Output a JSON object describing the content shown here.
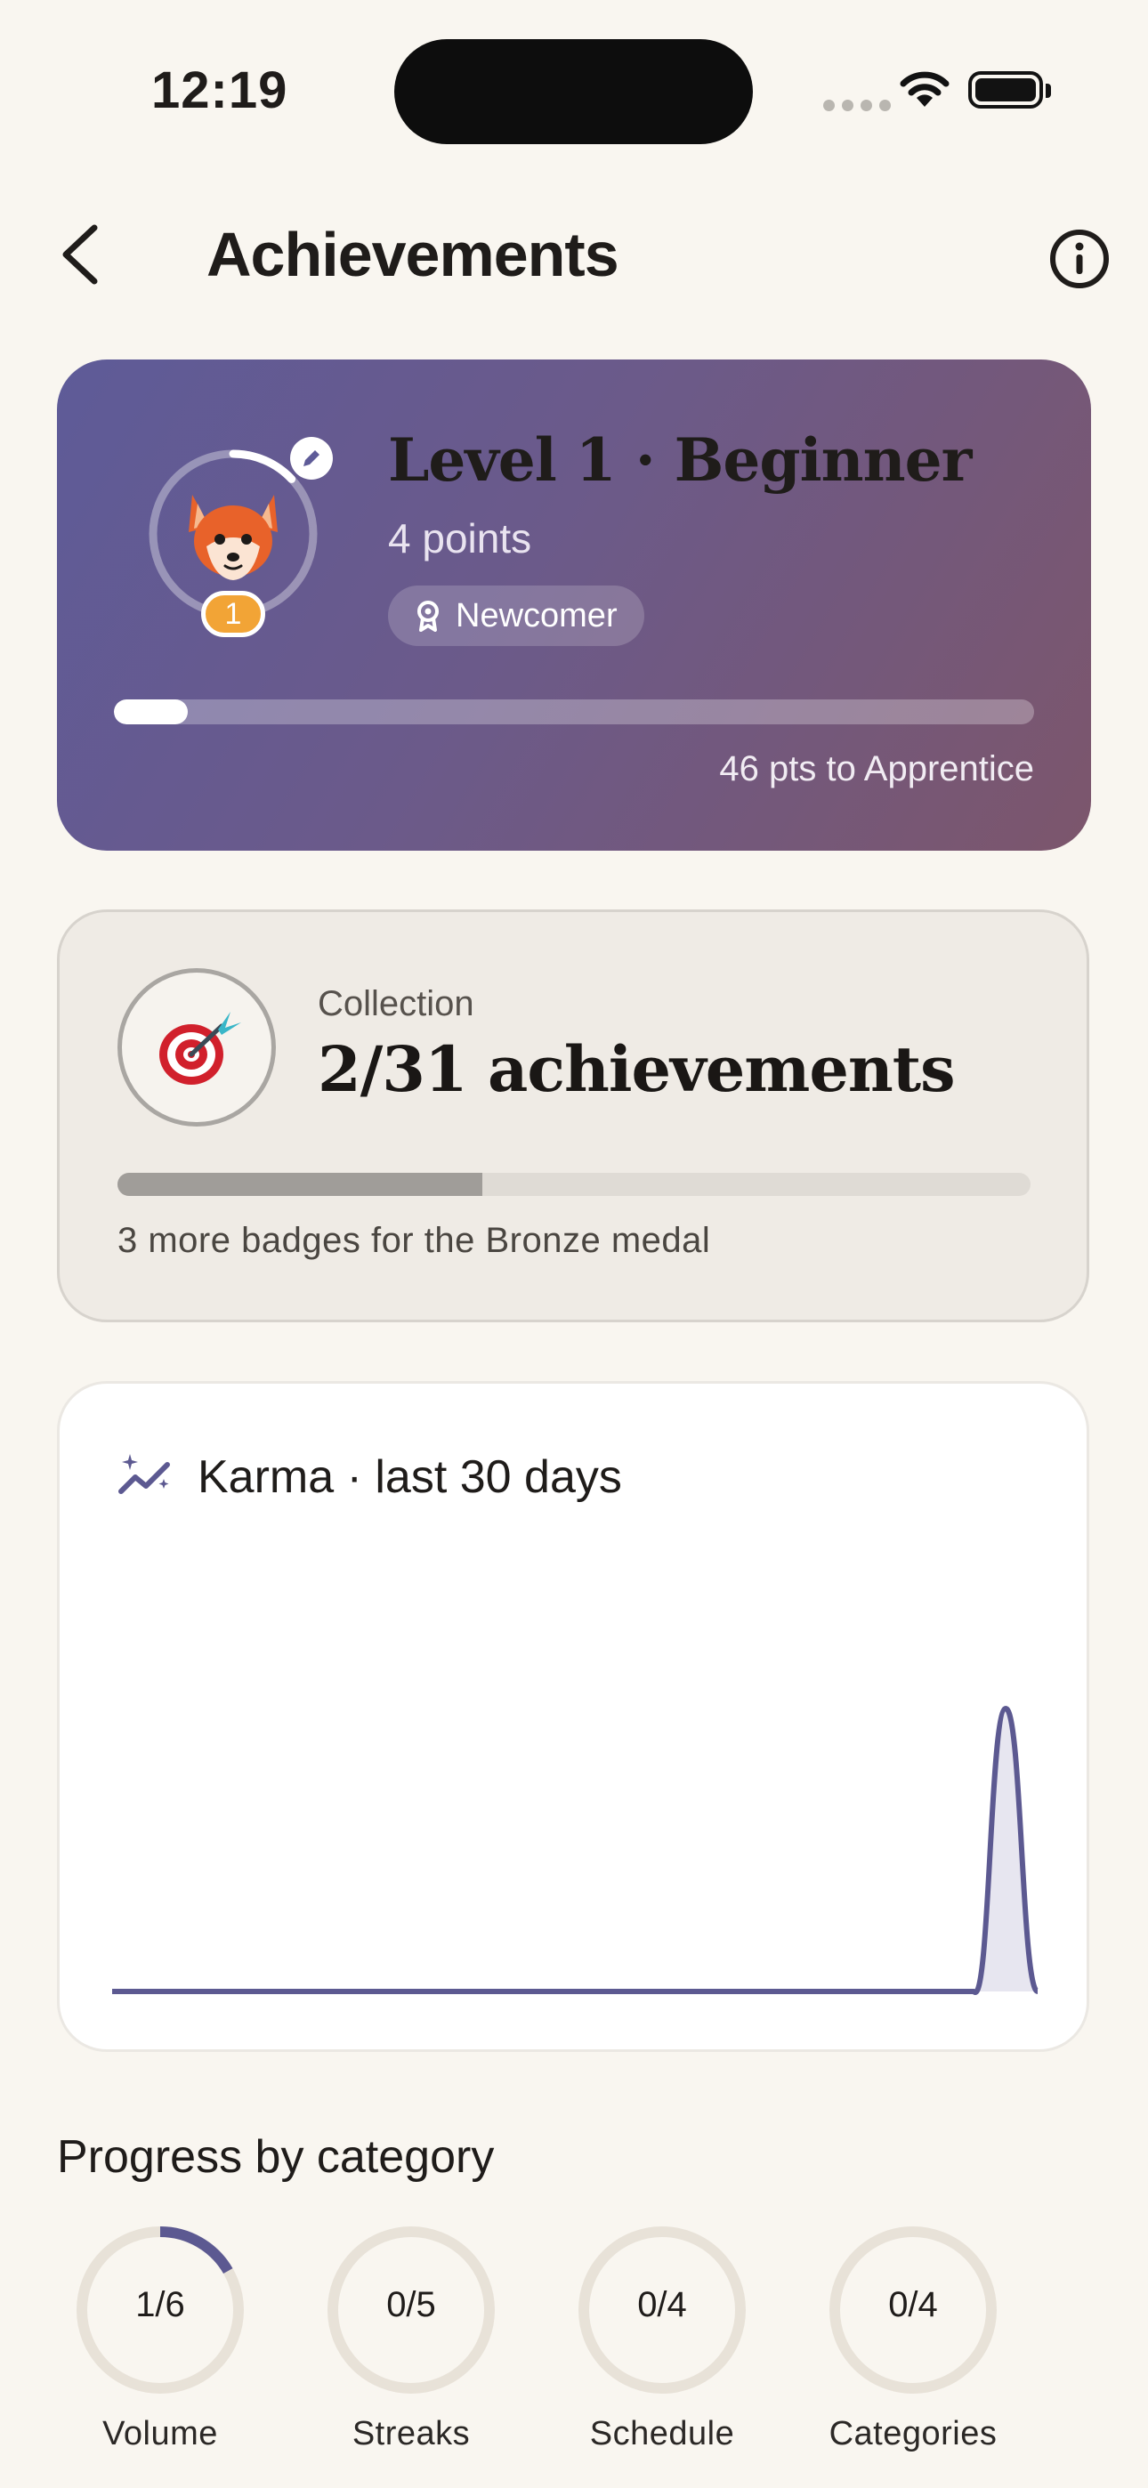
{
  "status_bar": {
    "time": "12:19"
  },
  "header": {
    "title": "Achievements"
  },
  "level_card": {
    "title": "Level 1 · Beginner",
    "points": "4 points",
    "rank": "Newcomer",
    "level_number": "1",
    "progress_fraction": 0.08,
    "avatar_ring_fraction": 0.13,
    "next_caption": "46 pts to Apprentice"
  },
  "collection": {
    "label": "Collection",
    "value": "2/31 achievements",
    "progress_fraction": 0.4,
    "caption": "3 more badges for the Bronze medal"
  },
  "karma": {
    "title": "Karma · last 30 days",
    "chart_data": {
      "type": "area",
      "title": "Karma · last 30 days",
      "x": [
        1,
        2,
        3,
        4,
        5,
        6,
        7,
        8,
        9,
        10,
        11,
        12,
        13,
        14,
        15,
        16,
        17,
        18,
        19,
        20,
        21,
        22,
        23,
        24,
        25,
        26,
        27,
        28,
        29,
        30
      ],
      "series": [
        {
          "values": [
            0,
            0,
            0,
            0,
            0,
            0,
            0,
            0,
            0,
            0,
            0,
            0,
            0,
            0,
            0,
            0,
            0,
            0,
            0,
            0,
            0,
            0,
            0,
            0,
            0,
            0,
            0,
            0,
            4,
            0
          ]
        }
      ],
      "grid": false,
      "color": "#5c5991"
    }
  },
  "categories_section": {
    "title": "Progress by category",
    "items": [
      {
        "value": "1/6",
        "label": "Volume",
        "fraction": 0.1667
      },
      {
        "value": "0/5",
        "label": "Streaks",
        "fraction": 0
      },
      {
        "value": "0/4",
        "label": "Schedule",
        "fraction": 0
      },
      {
        "value": "0/4",
        "label": "Categories",
        "fraction": 0
      }
    ],
    "accent": "#5c5991",
    "track": "#e8e2d8"
  }
}
